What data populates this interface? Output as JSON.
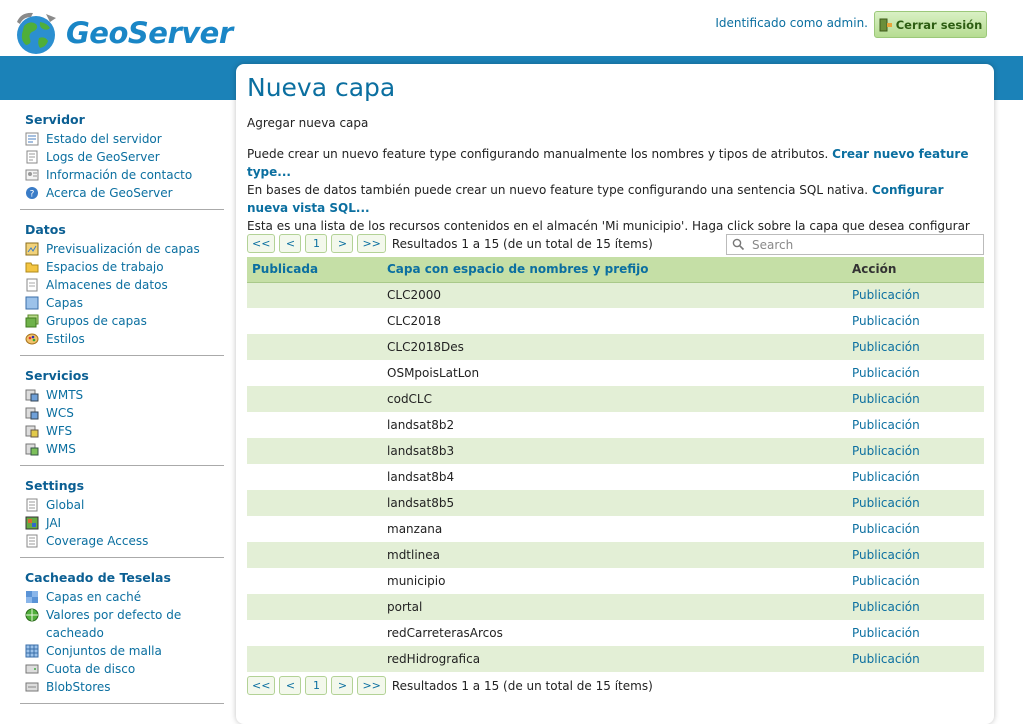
{
  "header": {
    "logo_text": "GeoServer",
    "user_info": "Identificado como admin.",
    "logout_label": "Cerrar sesión"
  },
  "sidebar": {
    "sections": [
      {
        "title": "Servidor",
        "items": [
          {
            "label": "Estado del servidor",
            "icon": "server-status-icon"
          },
          {
            "label": "Logs de GeoServer",
            "icon": "logs-icon"
          },
          {
            "label": "Información de contacto",
            "icon": "contact-icon"
          },
          {
            "label": "Acerca de GeoServer",
            "icon": "about-icon"
          }
        ]
      },
      {
        "title": "Datos",
        "items": [
          {
            "label": "Previsualización de capas",
            "icon": "layer-preview-icon"
          },
          {
            "label": "Espacios de trabajo",
            "icon": "workspace-folder-icon"
          },
          {
            "label": "Almacenes de datos",
            "icon": "datastore-icon"
          },
          {
            "label": "Capas",
            "icon": "layers-icon"
          },
          {
            "label": "Grupos de capas",
            "icon": "layer-groups-icon"
          },
          {
            "label": "Estilos",
            "icon": "styles-icon"
          }
        ]
      },
      {
        "title": "Servicios",
        "items": [
          {
            "label": "WMTS",
            "icon": "service-icon"
          },
          {
            "label": "WCS",
            "icon": "service-icon"
          },
          {
            "label": "WFS",
            "icon": "service-icon"
          },
          {
            "label": "WMS",
            "icon": "service-icon"
          }
        ]
      },
      {
        "title": "Settings",
        "items": [
          {
            "label": "Global",
            "icon": "global-settings-icon"
          },
          {
            "label": "JAI",
            "icon": "jai-icon"
          },
          {
            "label": "Coverage Access",
            "icon": "coverage-access-icon"
          }
        ]
      },
      {
        "title": "Cacheado de Teselas",
        "items": [
          {
            "label": "Capas en caché",
            "icon": "tile-layers-icon"
          },
          {
            "label": "Valores por defecto de cacheado",
            "icon": "caching-defaults-icon"
          },
          {
            "label": "Conjuntos de malla",
            "icon": "gridsets-icon"
          },
          {
            "label": "Cuota de disco",
            "icon": "disk-quota-icon"
          },
          {
            "label": "BlobStores",
            "icon": "blobstores-icon"
          }
        ]
      }
    ]
  },
  "main": {
    "title": "Nueva capa",
    "subtitle": "Agregar nueva capa",
    "desc_line1": "Puede crear un nuevo feature type configurando manualmente los nombres y tipos de atributos.",
    "desc_link1": "Crear nuevo feature type...",
    "desc_line2": "En bases de datos también puede crear un nuevo feature type configurando una sentencia SQL nativa.",
    "desc_link2": "Configurar nueva vista SQL...",
    "desc_line3": "Esta es una lista de los recursos contenidos en el almacén 'Mi municipio'. Haga click sobre la capa que desea configurar",
    "pager": {
      "first": "<<",
      "prev": "<",
      "page": "1",
      "next": ">",
      "last": ">>",
      "info": "Resultados 1 a 15 (de un total de 15 ítems)"
    },
    "search_placeholder": "Search",
    "table": {
      "headers": {
        "published": "Publicada",
        "name": "Capa con espacio de nombres y prefijo",
        "action": "Acción"
      },
      "rows": [
        {
          "published": "",
          "name": "CLC2000",
          "action": "Publicación"
        },
        {
          "published": "",
          "name": "CLC2018",
          "action": "Publicación"
        },
        {
          "published": "",
          "name": "CLC2018Des",
          "action": "Publicación"
        },
        {
          "published": "",
          "name": "OSMpoisLatLon",
          "action": "Publicación"
        },
        {
          "published": "",
          "name": "codCLC",
          "action": "Publicación"
        },
        {
          "published": "",
          "name": "landsat8b2",
          "action": "Publicación"
        },
        {
          "published": "",
          "name": "landsat8b3",
          "action": "Publicación"
        },
        {
          "published": "",
          "name": "landsat8b4",
          "action": "Publicación"
        },
        {
          "published": "",
          "name": "landsat8b5",
          "action": "Publicación"
        },
        {
          "published": "",
          "name": "manzana",
          "action": "Publicación"
        },
        {
          "published": "",
          "name": "mdtlinea",
          "action": "Publicación"
        },
        {
          "published": "",
          "name": "municipio",
          "action": "Publicación"
        },
        {
          "published": "",
          "name": "portal",
          "action": "Publicación"
        },
        {
          "published": "",
          "name": "redCarreterasArcos",
          "action": "Publicación"
        },
        {
          "published": "",
          "name": "redHidrografica",
          "action": "Publicación"
        }
      ]
    }
  },
  "colors": {
    "brand_blue": "#1b82b8",
    "link": "#0b6fa0",
    "table_header": "#c5dfa6",
    "row_stripe": "#e3efd6"
  }
}
